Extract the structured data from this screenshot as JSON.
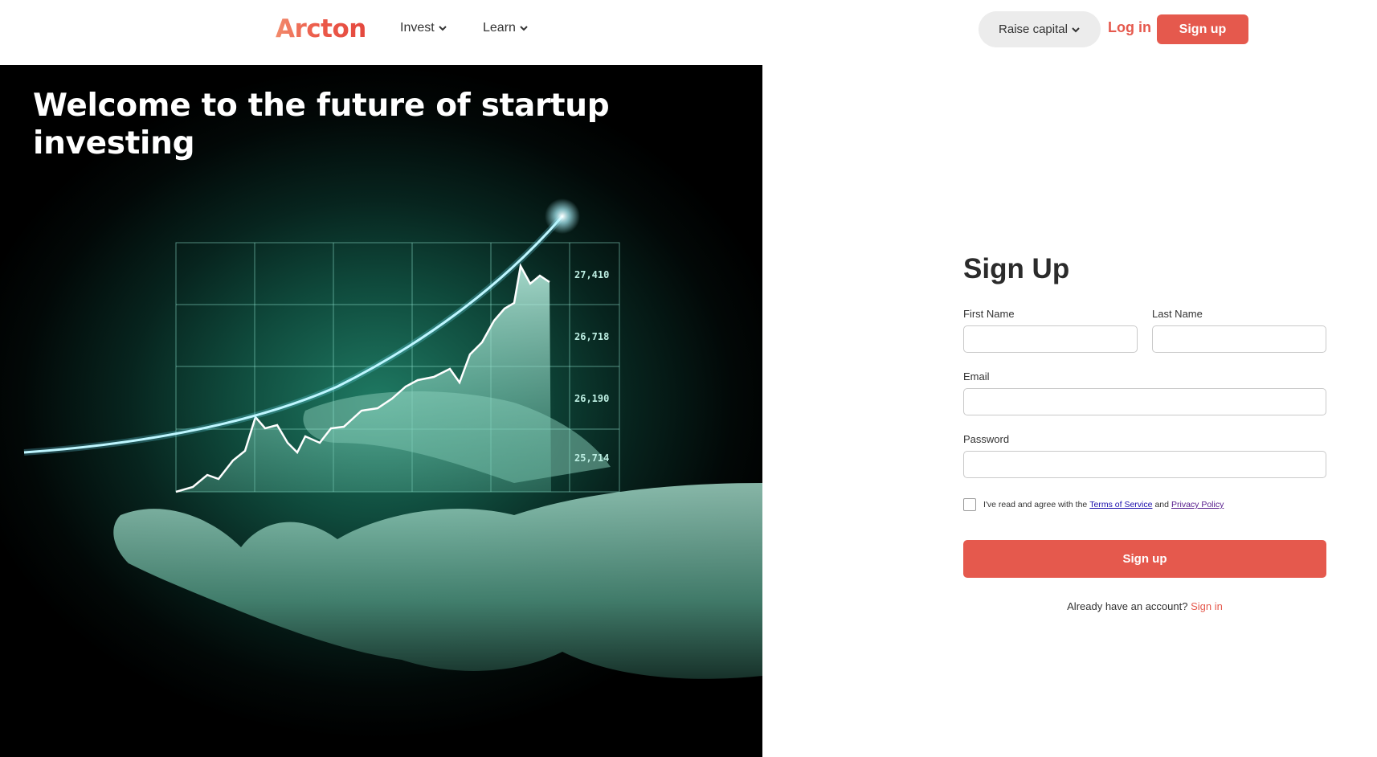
{
  "header": {
    "logo": "Arcton",
    "nav": [
      {
        "label": "Invest"
      },
      {
        "label": "Learn"
      }
    ],
    "raise_capital": "Raise capital",
    "login": "Log in",
    "signup": "Sign up",
    "brand_color": "#e5594d"
  },
  "hero": {
    "title": "Welcome to the future of startup investing",
    "chart_ticks": [
      "27,410",
      "26,718",
      "26,190",
      "25,714"
    ]
  },
  "form": {
    "title": "Sign Up",
    "first_name_label": "First Name",
    "last_name_label": "Last Name",
    "email_label": "Email",
    "password_label": "Password",
    "agree_prefix": "I've read and agree with the",
    "terms": "Terms of Service",
    "and": "and",
    "privacy": "Privacy Policy",
    "submit": "Sign up",
    "already": "Already have an account?",
    "signin": "Sign in"
  }
}
